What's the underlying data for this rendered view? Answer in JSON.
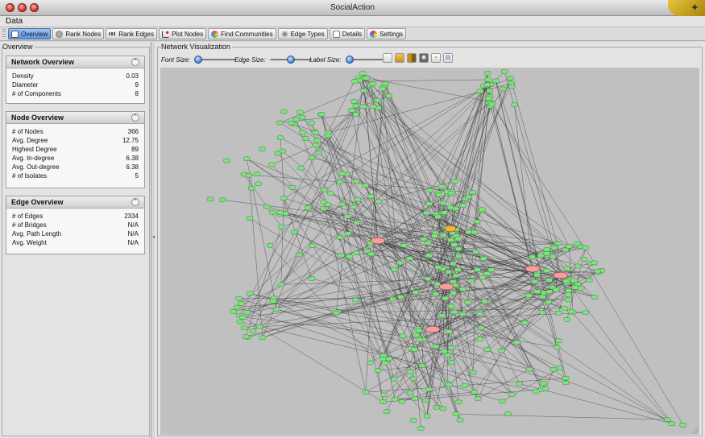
{
  "window": {
    "title": "SocialAction"
  },
  "menu": {
    "data_label": "Data"
  },
  "toolbar": {
    "tabs": [
      {
        "label": "Overview",
        "icon": "overview-icon",
        "active": true
      },
      {
        "label": "Rank Nodes",
        "icon": "rank-nodes-icon"
      },
      {
        "label": "Rank Edges",
        "icon": "rank-edges-icon"
      },
      {
        "label": "Plot Nodes",
        "icon": "plot-nodes-icon"
      },
      {
        "label": "Find Communities",
        "icon": "find-communities-icon"
      },
      {
        "label": "Edge Types",
        "icon": "edge-types-icon"
      },
      {
        "label": "Details",
        "icon": "details-icon"
      },
      {
        "label": "Settings",
        "icon": "settings-icon"
      }
    ]
  },
  "overview": {
    "section_title": "Overview",
    "network": {
      "title": "Network Overview",
      "rows": [
        {
          "label": "Density",
          "value": "0.03"
        },
        {
          "label": "Diameter",
          "value": "9"
        },
        {
          "label": "# of Components",
          "value": "8"
        }
      ]
    },
    "node": {
      "title": "Node Overview",
      "rows": [
        {
          "label": "# of Nodes",
          "value": "366"
        },
        {
          "label": "Avg. Degree",
          "value": "12.75"
        },
        {
          "label": "Highest Degree",
          "value": "89"
        },
        {
          "label": "Avg. In-degree",
          "value": "6.38"
        },
        {
          "label": "Avg. Out-degree",
          "value": "6.38"
        },
        {
          "label": "# of Isolates",
          "value": "5"
        }
      ]
    },
    "edge": {
      "title": "Edge Overview",
      "rows": [
        {
          "label": "# of Edges",
          "value": "2334"
        },
        {
          "label": "# of Bridges",
          "value": "N/A"
        },
        {
          "label": "Avg. Path Length",
          "value": "N/A"
        },
        {
          "label": "Avg. Weight",
          "value": "N/A"
        }
      ]
    }
  },
  "visualization": {
    "section_title": "Network Visualization",
    "font_size_label": "Font Size:",
    "edge_size_label": "Edge Size:",
    "label_size_label": "Label Size:",
    "font_size_level": 0.0,
    "edge_size_level": 0.5,
    "label_size_level": 0.0
  },
  "colors": {
    "node_fill": "#7fe07f",
    "node_highlight": "#f0a0a0",
    "node_selected": "#f2b53a",
    "canvas_bg": "#c0c0c0",
    "edge": "#3a3a3a",
    "active_tab": "#5f92d6"
  }
}
